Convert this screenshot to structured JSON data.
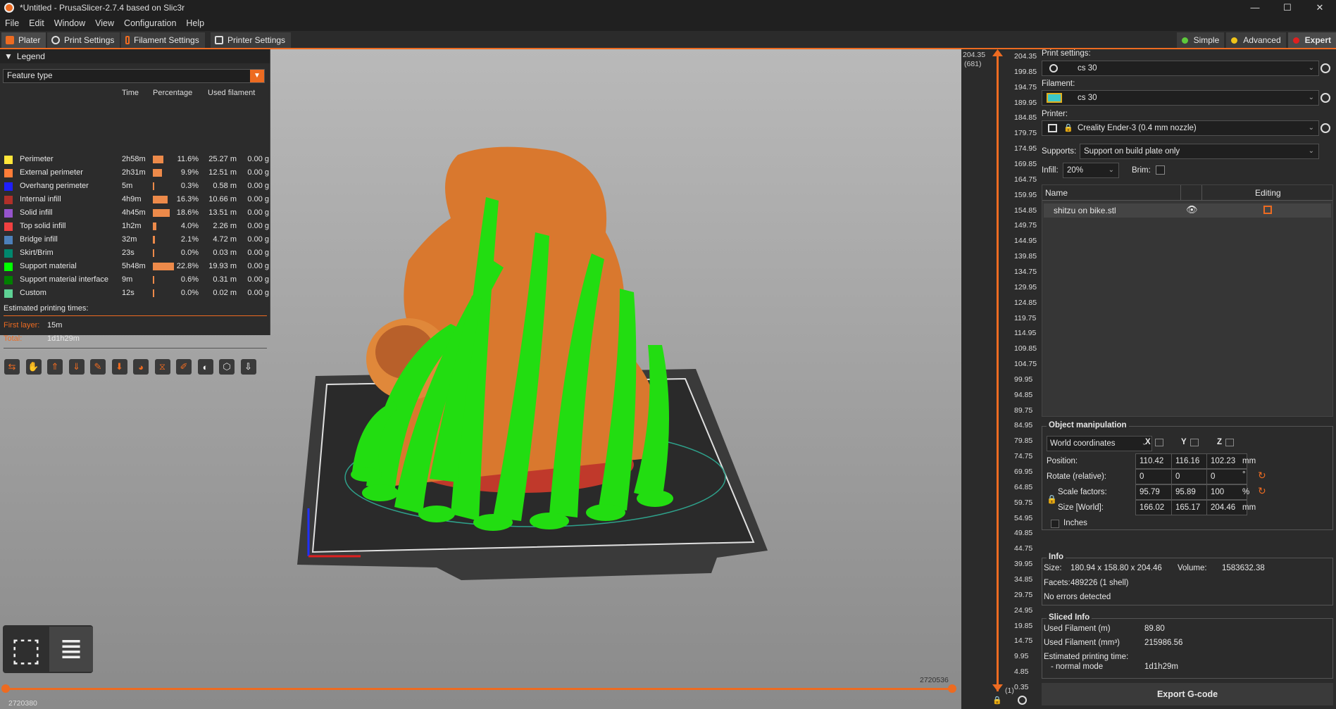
{
  "window": {
    "title": "*Untitled - PrusaSlicer-2.7.4 based on Slic3r",
    "controls": [
      "—",
      "☐",
      "✕"
    ]
  },
  "menu": [
    "File",
    "Edit",
    "Window",
    "View",
    "Configuration",
    "Help"
  ],
  "tabs": [
    {
      "label": "Plater"
    },
    {
      "label": "Print Settings"
    },
    {
      "label": "Filament Settings"
    },
    {
      "label": "Printer Settings"
    }
  ],
  "modes": [
    {
      "label": "Simple",
      "color": "#5ec93b"
    },
    {
      "label": "Advanced",
      "color": "#f0c419"
    },
    {
      "label": "Expert",
      "color": "#e02020"
    }
  ],
  "legend": {
    "header": "Legend",
    "feature_type": "Feature type",
    "columns": {
      "time": "Time",
      "percentage": "Percentage",
      "used_filament": "Used filament"
    },
    "rows": [
      {
        "name": "Perimeter",
        "color": "#ffe63a",
        "time": "2h58m",
        "pct": "11.6%",
        "pct_value": 11.6,
        "length": "25.27 m",
        "weight": "0.00 g"
      },
      {
        "name": "External perimeter",
        "color": "#ff7d38",
        "time": "2h31m",
        "pct": "9.9%",
        "pct_value": 9.9,
        "length": "12.51 m",
        "weight": "0.00 g"
      },
      {
        "name": "Overhang perimeter",
        "color": "#1f1fff",
        "time": "5m",
        "pct": "0.3%",
        "pct_value": 0.3,
        "length": "0.58 m",
        "weight": "0.00 g"
      },
      {
        "name": "Internal infill",
        "color": "#b03029",
        "time": "4h9m",
        "pct": "16.3%",
        "pct_value": 16.3,
        "length": "10.66 m",
        "weight": "0.00 g"
      },
      {
        "name": "Solid infill",
        "color": "#9654cc",
        "time": "4h45m",
        "pct": "18.6%",
        "pct_value": 18.6,
        "length": "13.51 m",
        "weight": "0.00 g"
      },
      {
        "name": "Top solid infill",
        "color": "#f04040",
        "time": "1h2m",
        "pct": "4.0%",
        "pct_value": 4.0,
        "length": "2.26 m",
        "weight": "0.00 g"
      },
      {
        "name": "Bridge infill",
        "color": "#4d80ba",
        "time": "32m",
        "pct": "2.1%",
        "pct_value": 2.1,
        "length": "4.72 m",
        "weight": "0.00 g"
      },
      {
        "name": "Skirt/Brim",
        "color": "#00876e",
        "time": "23s",
        "pct": "0.0%",
        "pct_value": 0.0,
        "length": "0.03 m",
        "weight": "0.00 g"
      },
      {
        "name": "Support material",
        "color": "#00ff00",
        "time": "5h48m",
        "pct": "22.8%",
        "pct_value": 22.8,
        "length": "19.93 m",
        "weight": "0.00 g"
      },
      {
        "name": "Support material interface",
        "color": "#008000",
        "time": "9m",
        "pct": "0.6%",
        "pct_value": 0.6,
        "length": "0.31 m",
        "weight": "0.00 g"
      },
      {
        "name": "Custom",
        "color": "#5ed194",
        "time": "12s",
        "pct": "0.0%",
        "pct_value": 0.0,
        "length": "0.02 m",
        "weight": "0.00 g"
      }
    ],
    "estimated_label": "Estimated printing times:",
    "first_layer_label": "First layer:",
    "first_layer_value": "15m",
    "total_label": "Total:",
    "total_value": "1d1h29m"
  },
  "vertical_slider": {
    "top_value": "204.35",
    "top_layer": "(681)",
    "bottom_layer": "(1)",
    "ticks": [
      "204.35",
      "199.85",
      "194.75",
      "189.95",
      "184.85",
      "179.75",
      "174.95",
      "169.85",
      "164.75",
      "159.95",
      "154.85",
      "149.75",
      "144.95",
      "139.85",
      "134.75",
      "129.95",
      "124.85",
      "119.75",
      "114.95",
      "109.85",
      "104.75",
      "99.95",
      "94.85",
      "89.75",
      "84.95",
      "79.85",
      "74.75",
      "69.95",
      "64.85",
      "59.75",
      "54.95",
      "49.85",
      "44.75",
      "39.95",
      "34.85",
      "29.75",
      "24.95",
      "19.85",
      "14.75",
      "9.95",
      "4.85",
      "0.35"
    ]
  },
  "horizontal_slider": {
    "left_value": "2720380",
    "right_value": "2720536"
  },
  "right_panel": {
    "print_settings_label": "Print settings:",
    "print_settings_value": "cs 30",
    "filament_label": "Filament:",
    "filament_value": "cs 30",
    "filament_color": "#3cc8c8",
    "printer_label": "Printer:",
    "printer_value": "Creality Ender-3 (0.4 mm nozzle)",
    "supports_label": "Supports:",
    "supports_value": "Support on build plate only",
    "infill_label": "Infill:",
    "infill_value": "20%",
    "brim_label": "Brim:",
    "list_name_header": "Name",
    "list_editing_header": "Editing",
    "object_name": "shitzu on bike.stl",
    "object_manipulation": {
      "title": "Object manipulation",
      "coordinates": "World coordinates",
      "x": "X",
      "y": "Y",
      "z": "Z",
      "position_label": "Position:",
      "position": [
        "110.42",
        "116.16",
        "102.23"
      ],
      "position_unit": "mm",
      "rotate_label": "Rotate (relative):",
      "rotate": [
        "0",
        "0",
        "0"
      ],
      "rotate_unit": "°",
      "scale_label": "Scale factors:",
      "scale": [
        "95.79",
        "95.89",
        "100"
      ],
      "scale_unit": "%",
      "size_label": "Size [World]:",
      "size": [
        "166.02",
        "165.17",
        "204.46"
      ],
      "size_unit": "mm",
      "inches_label": "Inches"
    },
    "info": {
      "title": "Info",
      "size_label": "Size:",
      "size_value": "180.94 x 158.80 x 204.46",
      "volume_label": "Volume:",
      "volume_value": "1583632.38",
      "facets_label": "Facets:",
      "facets_value": "489226 (1 shell)",
      "errors": "No errors detected"
    },
    "sliced_info": {
      "title": "Sliced Info",
      "used_m_label": "Used Filament (m)",
      "used_m_value": "89.80",
      "used_mm3_label": "Used Filament (mm³)",
      "used_mm3_value": "215986.56",
      "est_label": "Estimated printing time:",
      "normal_label": "- normal mode",
      "normal_value": "1d1h29m"
    },
    "export_label": "Export G-code"
  }
}
